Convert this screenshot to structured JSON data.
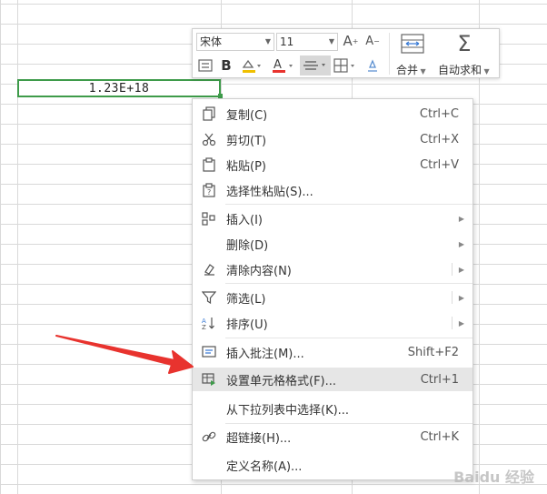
{
  "cell": {
    "value": "1.23E+18"
  },
  "toolbar": {
    "font_name": "宋体",
    "font_size": "11",
    "bold_label": "B",
    "merge_label": "合并",
    "autosum_label": "自动求和"
  },
  "menu": {
    "items": [
      {
        "label": "复制(C)",
        "shortcut": "Ctrl+C",
        "icon": "copy-icon"
      },
      {
        "label": "剪切(T)",
        "shortcut": "Ctrl+X",
        "icon": "scissors-icon"
      },
      {
        "label": "粘贴(P)",
        "shortcut": "Ctrl+V",
        "icon": "paste-icon"
      },
      {
        "label": "选择性粘贴(S)...",
        "shortcut": "",
        "icon": "paste-special-icon"
      },
      {
        "label": "插入(I)",
        "shortcut": "",
        "icon": "insert-icon"
      },
      {
        "label": "删除(D)",
        "shortcut": "",
        "icon": ""
      },
      {
        "label": "清除内容(N)",
        "shortcut": "",
        "icon": "eraser-icon"
      },
      {
        "label": "筛选(L)",
        "shortcut": "",
        "icon": "filter-icon"
      },
      {
        "label": "排序(U)",
        "shortcut": "",
        "icon": "sort-icon"
      },
      {
        "label": "插入批注(M)...",
        "shortcut": "Shift+F2",
        "icon": "comment-icon"
      },
      {
        "label": "设置单元格格式(F)...",
        "shortcut": "Ctrl+1",
        "icon": "format-cells-icon"
      },
      {
        "label": "从下拉列表中选择(K)...",
        "shortcut": "",
        "icon": ""
      },
      {
        "label": "超链接(H)...",
        "shortcut": "Ctrl+K",
        "icon": "link-icon"
      },
      {
        "label": "定义名称(A)...",
        "shortcut": "",
        "icon": ""
      }
    ]
  },
  "watermark": "Baidu 经验",
  "colors": {
    "accent_green": "#3e9b4a",
    "arrow_red": "#e8332e",
    "highlight": "#e6e6e6"
  }
}
